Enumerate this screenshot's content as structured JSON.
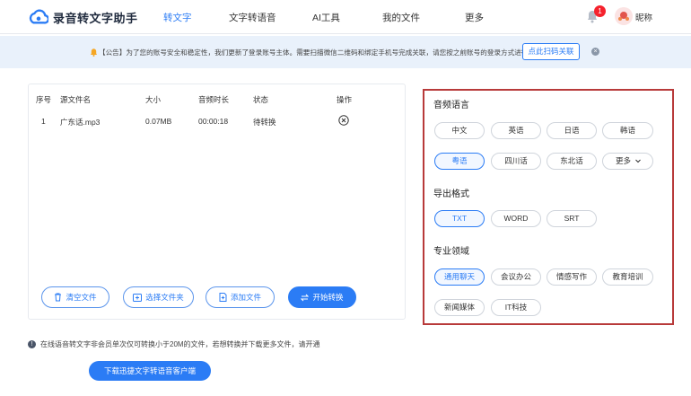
{
  "header": {
    "app_name": "录音转文字助手",
    "nav": [
      "转文字",
      "文字转语音",
      "AI工具",
      "我的文件",
      "更多"
    ],
    "notification_count": "1",
    "nickname": "昵称"
  },
  "notice": {
    "text": "【公告】为了您的账号安全和稳定性，我们更新了登录账号主体。需要扫描微信二维码和绑定手机号完成关联，请您按之前账号的登录方式进行关联。",
    "button": "点此扫码关联"
  },
  "table": {
    "columns": [
      "序号",
      "源文件名",
      "大小",
      "音频时长",
      "状态",
      "操作"
    ],
    "rows": [
      {
        "index": "1",
        "name": "广东话.mp3",
        "size": "0.07MB",
        "duration": "00:00:18",
        "status": "待转换"
      }
    ]
  },
  "actions": {
    "clear": "清空文件",
    "select_folder": "选择文件夹",
    "add_file": "添加文件",
    "start": "开始转换"
  },
  "info": "在线语音转文字非会员单次仅可转换小于20M的文件，若想转换并下载更多文件，请开通",
  "download_button": "下载迅捷文字转语音客户端",
  "settings": {
    "language_title": "音频语言",
    "languages": [
      "中文",
      "英语",
      "日语",
      "韩语",
      "粤语",
      "四川话",
      "东北话",
      "更多"
    ],
    "language_selected": "粤语",
    "format_title": "导出格式",
    "formats": [
      "TXT",
      "WORD",
      "SRT"
    ],
    "format_selected": "TXT",
    "domain_title": "专业领域",
    "domains": [
      "通用聊天",
      "会议办公",
      "情感写作",
      "教育培训",
      "新闻媒体",
      "IT科技"
    ],
    "domain_selected": "通用聊天"
  },
  "colors": {
    "accent": "#2b7cf5",
    "notice_bg": "#e9f1fb",
    "highlight_border": "#b83a3a",
    "badge": "#f5222d"
  }
}
